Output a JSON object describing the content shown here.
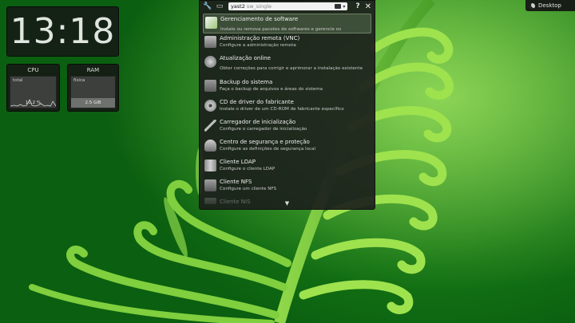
{
  "desktop_button": {
    "label": "Desktop",
    "icon": "moon-icon"
  },
  "clock": {
    "time": "13:18"
  },
  "cpu_monitor": {
    "title": "CPU",
    "series_label": "total",
    "value_text": "10.2 %",
    "usage_percent": 10.2
  },
  "ram_monitor": {
    "title": "RAM",
    "series_label": "física",
    "value_text": "2.5 GiB",
    "usage_fraction": 0.3
  },
  "launcher": {
    "search": {
      "value": "yast2",
      "placeholder": "sw_single"
    },
    "tools": {
      "settings_icon": "wrench-icon",
      "view_icon": "window-icon",
      "help": "?",
      "close": "✕"
    },
    "items": [
      {
        "name": "Gerenciamento de software",
        "desc": "Instale ou remova pacotes de softwares e gerencie os",
        "icon": "software-management-icon"
      },
      {
        "name": "Administração remota (VNC)",
        "desc": "Configure a administração remota",
        "icon": "monitor-icon"
      },
      {
        "name": "Atualização online",
        "desc": "Obter correções para corrigir e aprimorar a instalação existente",
        "icon": "online-update-icon"
      },
      {
        "name": "Backup do sistema",
        "desc": "Faça o backup de arquivos e áreas do sistema",
        "icon": "backup-icon"
      },
      {
        "name": "CD de driver do fabricante",
        "desc": "Instale o driver de um CD-ROM de fabricante específico",
        "icon": "cd-icon"
      },
      {
        "name": "Carregador de inicialização",
        "desc": "Configure o carregador de inicialização",
        "icon": "boot-loader-icon"
      },
      {
        "name": "Centro de segurança e proteção",
        "desc": "Configure as definições de segurança local",
        "icon": "security-icon"
      },
      {
        "name": "Cliente LDAP",
        "desc": "Configure o cliente LDAP",
        "icon": "ldap-client-icon"
      },
      {
        "name": "Cliente NFS",
        "desc": "Configure um cliente NFS",
        "icon": "nfs-client-icon"
      },
      {
        "name": "Cliente NIS",
        "desc": "",
        "icon": "nis-client-icon"
      }
    ],
    "more_indicator": "▼"
  }
}
